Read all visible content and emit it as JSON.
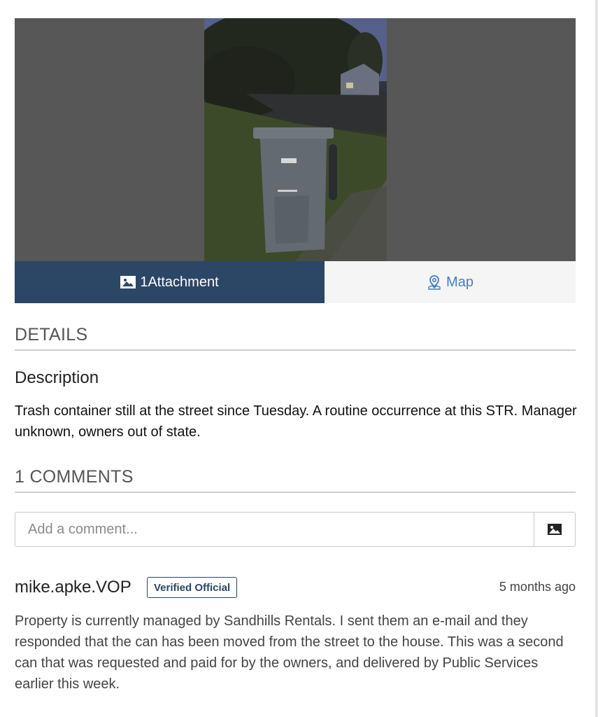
{
  "media": {
    "photo_alt": "Trash container at the curb at dusk"
  },
  "tabs": {
    "attachment_count": "1",
    "attachment_label": "Attachment",
    "map_label": "Map"
  },
  "details": {
    "heading": "DETAILS",
    "description_label": "Description",
    "description_text": "Trash container still at the street since Tuesday. A routine occurrence at this STR. Manager unknown, owners out of state."
  },
  "comments": {
    "heading": "1 COMMENTS",
    "input_placeholder": "Add a comment...",
    "items": [
      {
        "author": "mike.apke.VOP",
        "badge": "Verified Official",
        "time": "5 months ago",
        "body": "Property is currently managed by Sandhills Rentals.  I sent them an e-mail and they responded that the can has been moved from the street to the house.  This was a second can that was requested and paid for by the owners, and delivered by Public Services earlier this week."
      }
    ]
  },
  "colors": {
    "accent_dark": "#2c4666",
    "link_blue": "#3f7fc4",
    "media_bg": "#575757"
  },
  "icons": {
    "attachment": "image-icon",
    "map": "map-pin-icon",
    "comment_image": "image-icon"
  }
}
